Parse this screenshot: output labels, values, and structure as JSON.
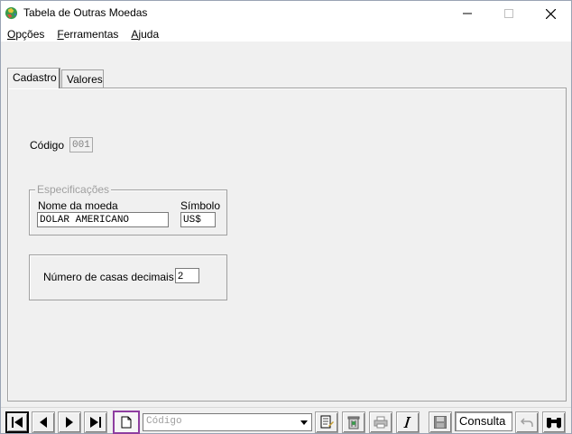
{
  "window": {
    "title": "Tabela de Outras Moedas"
  },
  "menu": {
    "items": [
      {
        "underline": "O",
        "rest": "pções"
      },
      {
        "underline": "F",
        "rest": "erramentas"
      },
      {
        "underline": "A",
        "rest": "juda"
      }
    ]
  },
  "tabs": [
    {
      "label": "Cadastro",
      "active": true
    },
    {
      "label": "Valores",
      "active": false
    }
  ],
  "form": {
    "codigo_label": "Código",
    "codigo_value": "001",
    "especificacoes_label": "Especificações",
    "nome_label": "Nome da moeda",
    "nome_value": "DOLAR AMERICANO",
    "simbolo_label": "Símbolo",
    "simbolo_value": "US$",
    "casas_label": "Número de casas decimais",
    "casas_value": "2"
  },
  "toolbar": {
    "combo_placeholder": "Código",
    "status": "Consulta"
  },
  "colors": {
    "highlight": "#8e3ea0"
  }
}
